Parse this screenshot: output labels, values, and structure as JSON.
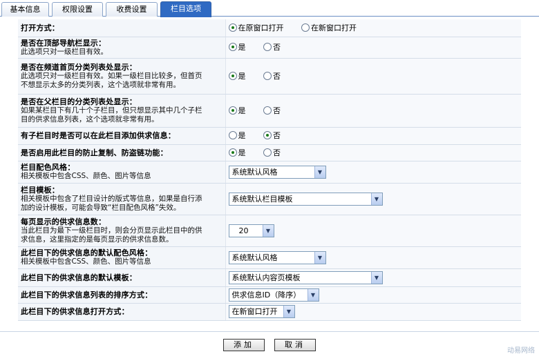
{
  "tabs": [
    {
      "label": "基本信息"
    },
    {
      "label": "权限设置"
    },
    {
      "label": "收费设置"
    },
    {
      "label": "栏目选项"
    }
  ],
  "rows": {
    "open_mode": {
      "title": "打开方式：",
      "opt1": "在原窗口打开",
      "opt2": "在新窗口打开"
    },
    "top_nav": {
      "title": "是否在顶部导航栏显示：",
      "desc1": "此选项只对一级栏目有效。",
      "opt1": "是",
      "opt2": "否"
    },
    "channel_home": {
      "title": "是否在频道首页分类列表处显示：",
      "desc1": "此选项只对一级栏目有效。如果一级栏目比较多，但首页",
      "desc2": "不想显示太多的分类列表，这个选项就非常有用。",
      "opt1": "是",
      "opt2": "否"
    },
    "parent_list": {
      "title": "是否在父栏目的分类列表处显示：",
      "desc1": "如果某栏目下有几十个子栏目，但只想显示其中几个子栏",
      "desc2": "目的供求信息列表，这个选项就非常有用。",
      "opt1": "是",
      "opt2": "否"
    },
    "allow_add": {
      "title": "有子栏目时是否可以在此栏目添加供求信息：",
      "opt1": "是",
      "opt2": "否"
    },
    "anti_copy": {
      "title": "是否启用此栏目的防止复制、防盗链功能：",
      "opt1": "是",
      "opt2": "否"
    },
    "color_style": {
      "title": "栏目配色风格：",
      "desc1": "相关模板中包含CSS、颜色、图片等信息",
      "value": "系统默认风格"
    },
    "template": {
      "title": "栏目模板：",
      "desc1": "相关模板中包含了栏目设计的版式等信息，如果是自行添",
      "desc2": "加的设计模板，可能会导致“栏目配色风格”失效。",
      "value": "系统默认栏目模板"
    },
    "per_page": {
      "title": "每页显示的供求信息数：",
      "desc1": "当此栏目为最下一级栏目时，则会分页显示此栏目中的供",
      "desc2": "求信息，这里指定的是每页显示的供求信息数。",
      "value": "20"
    },
    "info_color": {
      "title": "此栏目下的供求信息的默认配色风格：",
      "desc1": "相关模板中包含CSS、颜色、图片等信息",
      "value": "系统默认风格"
    },
    "info_template": {
      "title": "此栏目下的供求信息的默认模板：",
      "value": "系统默认内容页模板"
    },
    "sort_mode": {
      "title": "此栏目下的供求信息列表的排序方式：",
      "value": "供求信息ID（降序）"
    },
    "info_open": {
      "title": "此栏目下的供求信息打开方式：",
      "value": "在新窗口打开"
    }
  },
  "buttons": {
    "add": "添加",
    "cancel": "取消"
  },
  "watermark": "动易网络"
}
